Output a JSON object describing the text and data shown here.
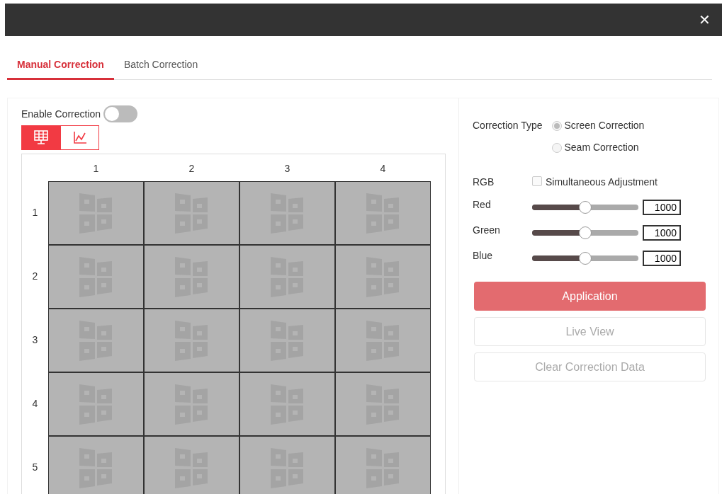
{
  "window": {
    "close": "✕"
  },
  "tabs": [
    {
      "label": "Manual Correction",
      "selected": true
    },
    {
      "label": "Batch Correction",
      "selected": false
    }
  ],
  "enable_correction": {
    "label": "Enable Correction",
    "on": false
  },
  "view_modes": [
    {
      "kind": "grid",
      "selected": true
    },
    {
      "kind": "chart",
      "selected": false
    }
  ],
  "screen_wall": {
    "columns": [
      "1",
      "2",
      "3",
      "4"
    ],
    "rows": [
      "1",
      "2",
      "3",
      "4",
      "5"
    ]
  },
  "correction_type": {
    "label": "Correction Type",
    "options": [
      {
        "label": "Screen Correction",
        "selected": true
      },
      {
        "label": "Seam Correction",
        "selected": false
      }
    ]
  },
  "rgb": {
    "label": "RGB",
    "simultaneous": {
      "label": "Simultaneous Adjustment",
      "checked": false
    }
  },
  "channels": [
    {
      "name": "Red",
      "level": 0.5,
      "value": "1000"
    },
    {
      "name": "Green",
      "level": 0.5,
      "value": "1000"
    },
    {
      "name": "Blue",
      "level": 0.5,
      "value": "1000"
    }
  ],
  "buttons": [
    {
      "label": "Application",
      "kind": "primary",
      "disabled": false
    },
    {
      "label": "Live View",
      "kind": "outline",
      "disabled": true
    },
    {
      "label": "Clear Correction Data",
      "kind": "outline",
      "disabled": true
    }
  ]
}
